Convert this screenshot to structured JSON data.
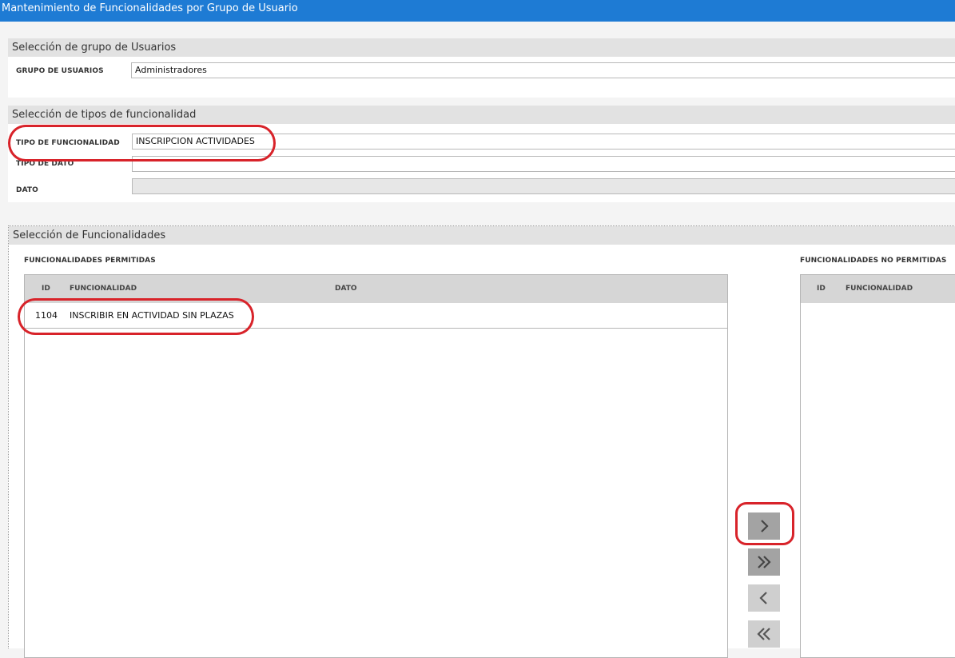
{
  "window": {
    "title": "Mantenimiento de Funcionalidades por Grupo de Usuario"
  },
  "user_group_section": {
    "header": "Selección de grupo de Usuarios",
    "group_label": "GRUPO DE USUARIOS",
    "group_value": "Administradores"
  },
  "type_section": {
    "header": "Selección de tipos de funcionalidad",
    "type_label": "TIPO DE FUNCIONALIDAD",
    "type_value": "INSCRIPCION ACTIVIDADES",
    "data_type_label": "TIPO DE DATO",
    "data_type_value": "",
    "data_label": "DATO",
    "data_value": ""
  },
  "functionalities_section": {
    "header": "Selección de Funcionalidades",
    "allowed_title": "FUNCIONALIDADES PERMITIDAS",
    "not_allowed_title": "FUNCIONALIDADES NO PERMITIDAS",
    "allowed_columns": [
      "ID",
      "FUNCIONALIDAD",
      "DATO"
    ],
    "not_allowed_columns": [
      "ID",
      "FUNCIONALIDAD"
    ],
    "allowed_rows": [
      {
        "id": "1104",
        "funcionalidad": "INSCRIBIR EN ACTIVIDAD SIN PLAZAS",
        "dato": ""
      }
    ],
    "buttons": [
      {
        "name": "move-one-right",
        "icon": "chevron-right-icon",
        "enabled": true
      },
      {
        "name": "move-all-right",
        "icon": "double-chevron-right-icon",
        "enabled": true
      },
      {
        "name": "move-one-left",
        "icon": "chevron-left-icon",
        "enabled": false
      },
      {
        "name": "move-all-left",
        "icon": "double-chevron-left-icon",
        "enabled": false
      }
    ]
  },
  "colors": {
    "titlebar": "#1e7bd4",
    "annotation": "#d8232a",
    "button": "#a3a3a3"
  }
}
